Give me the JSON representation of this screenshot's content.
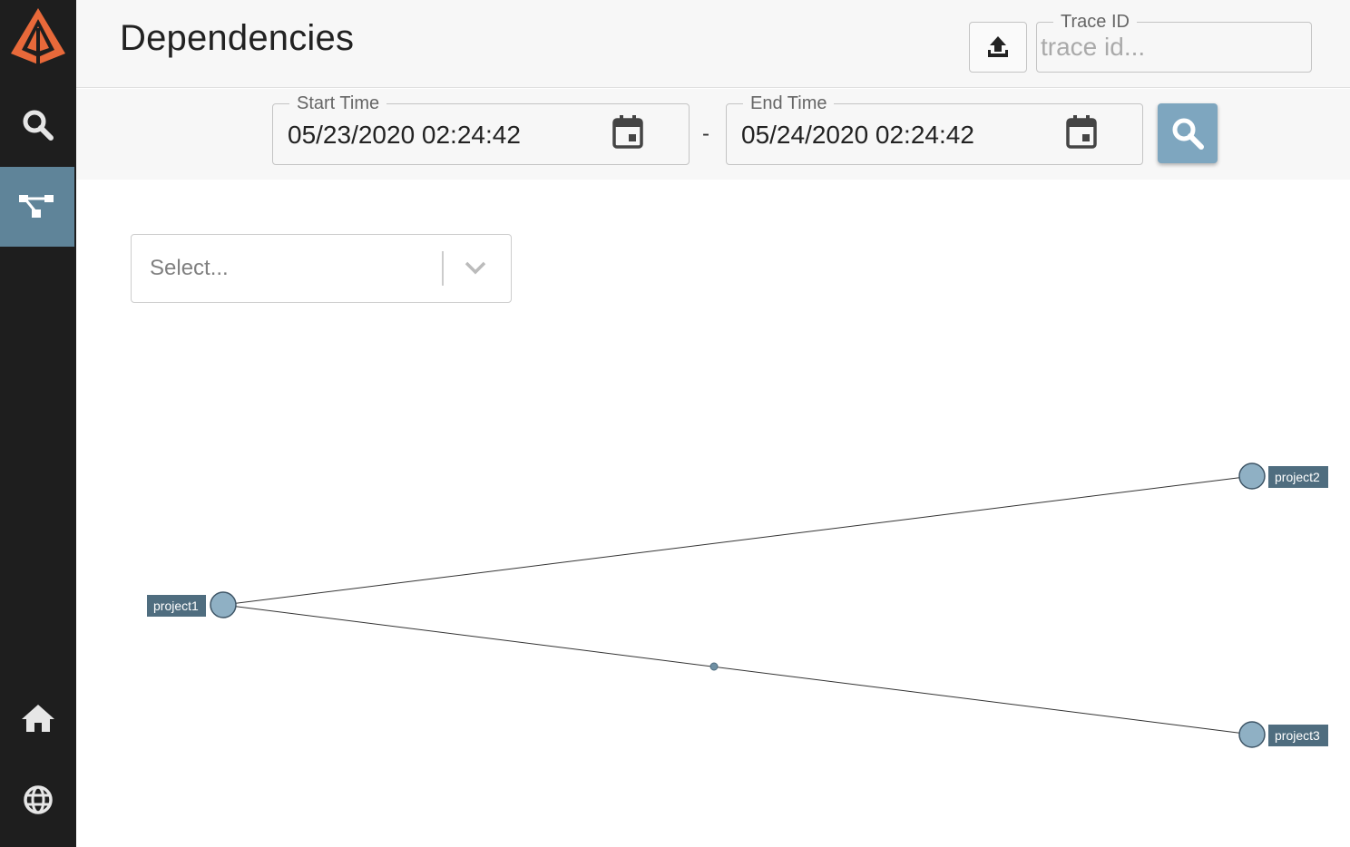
{
  "page": {
    "title": "Dependencies"
  },
  "trace": {
    "legend": "Trace ID",
    "placeholder": "trace id..."
  },
  "date_range": {
    "start_legend": "Start Time",
    "start_value": "05/23/2020 02:24:42",
    "separator": "-",
    "end_legend": "End Time",
    "end_value": "05/24/2020 02:24:42"
  },
  "select": {
    "placeholder": "Select..."
  },
  "sidebar": {
    "items": [
      {
        "name": "logo",
        "icon": "zipkin-logo-icon"
      },
      {
        "name": "search",
        "icon": "search-icon"
      },
      {
        "name": "dependencies",
        "icon": "dependency-graph-icon",
        "active": true
      },
      {
        "name": "home",
        "icon": "home-icon"
      },
      {
        "name": "language",
        "icon": "globe-icon"
      }
    ]
  },
  "graph": {
    "nodes": [
      "project1",
      "project2",
      "project3"
    ],
    "edges": [
      {
        "from": "project1",
        "to": "project2"
      },
      {
        "from": "project1",
        "to": "project3"
      }
    ]
  },
  "colors": {
    "sidebar_bg": "#1e1e1e",
    "active_nav": "#5f8499",
    "accent": "#7ea6bf",
    "node_fill": "#8fb0c4",
    "label_bg": "#4f6d7f",
    "logo_orange": "#e8693a"
  }
}
